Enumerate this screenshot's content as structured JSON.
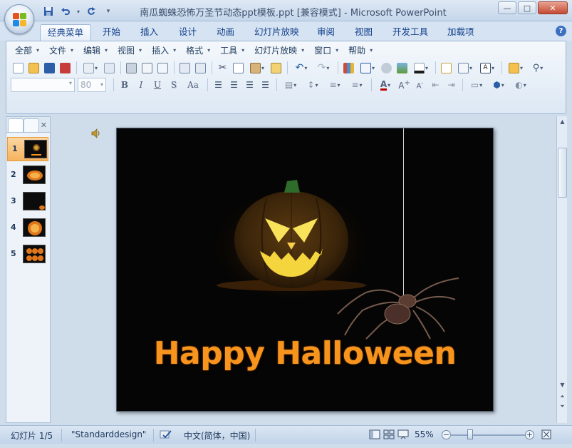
{
  "window": {
    "title": "南瓜蜘蛛恐怖万圣节动态ppt模板.ppt [兼容模式] - Microsoft PowerPoint",
    "minimize": "—",
    "maximize": "□",
    "close": "✕"
  },
  "ribbon_tabs": [
    "经典菜单",
    "开始",
    "插入",
    "设计",
    "动画",
    "幻灯片放映",
    "审阅",
    "视图",
    "开发工具",
    "加载项"
  ],
  "active_tab": "经典菜单",
  "classic_menu": [
    "全部",
    "文件",
    "编辑",
    "视图",
    "插入",
    "格式",
    "工具",
    "幻灯片放映",
    "窗口",
    "帮助"
  ],
  "format_bar": {
    "font_name": "",
    "font_size": "80",
    "bold": "B",
    "italic": "I",
    "underline": "U",
    "shadow": "S",
    "change_case": "Aa"
  },
  "slides_panel": {
    "slides": [
      {
        "num": "1",
        "selected": true
      },
      {
        "num": "2",
        "selected": false
      },
      {
        "num": "3",
        "selected": false
      },
      {
        "num": "4",
        "selected": false
      },
      {
        "num": "5",
        "selected": false
      }
    ],
    "close": "✕"
  },
  "slide": {
    "title": "Happy Halloween"
  },
  "status": {
    "slide_pos": "幻灯片 1/5",
    "theme": "\"Standarddesign\"",
    "language": "中文(简体，中国)",
    "zoom": "55%"
  },
  "colors": {
    "title_orange": "#f7941d",
    "slide_bg": "#050505",
    "selected_thumb": "#f5b35e"
  }
}
